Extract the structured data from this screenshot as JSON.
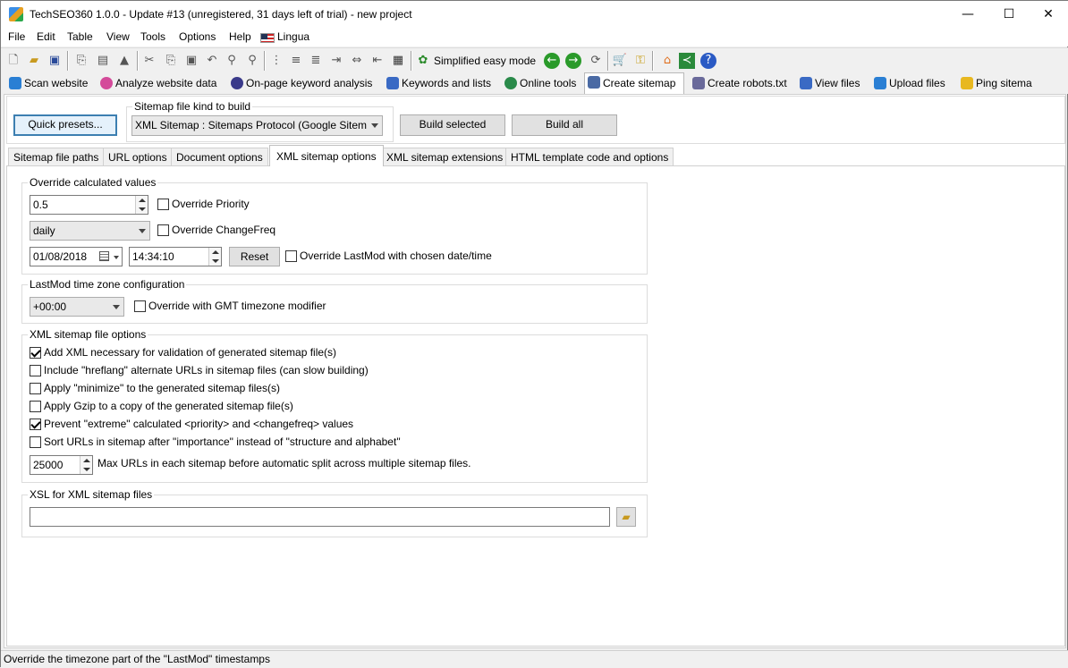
{
  "window": {
    "title": "TechSEO360 1.0.0 - Update #13 (unregistered, 31 days left of trial) - new project",
    "minimize": "—",
    "maximize": "☐",
    "close": "✕"
  },
  "menu": [
    "File",
    "Edit",
    "Table",
    "View",
    "Tools",
    "Options",
    "Help",
    "Lingua"
  ],
  "toolbar": {
    "simplified_mode": "Simplified easy mode"
  },
  "main_tabs": [
    {
      "label": "Scan website",
      "color": "#2a7fd4"
    },
    {
      "label": "Analyze website data",
      "color": "#d44a9a"
    },
    {
      "label": "On-page keyword analysis",
      "color": "#3a3a8a"
    },
    {
      "label": "Keywords and lists",
      "color": "#3a6ac4"
    },
    {
      "label": "Online tools",
      "color": "#2a8a4a"
    },
    {
      "label": "Create sitemap",
      "color": "#4a6aa4"
    },
    {
      "label": "Create robots.txt",
      "color": "#6a6a9a"
    },
    {
      "label": "View files",
      "color": "#3a6ac4"
    },
    {
      "label": "Upload files",
      "color": "#2a7fd4"
    },
    {
      "label": "Ping sitema",
      "color": "#e8b820"
    }
  ],
  "tab_scroll": {
    "left": "◂",
    "right": "▸"
  },
  "sitemap": {
    "quick_presets": "Quick presets...",
    "kind_label": "Sitemap file kind to build",
    "kind_value": "XML Sitemap : Sitemaps Protocol (Google Sitem",
    "build_selected": "Build selected",
    "build_all": "Build all"
  },
  "sub_tabs": [
    "Sitemap file paths",
    "URL options",
    "Document options",
    "XML sitemap options",
    "XML sitemap extensions",
    "HTML template code and options"
  ],
  "override": {
    "title": "Override calculated values",
    "priority_value": "0.5",
    "priority_label": "Override Priority",
    "changefreq_value": "daily",
    "changefreq_label": "Override ChangeFreq",
    "date_value": "01/08/2018",
    "time_value": "14:34:10",
    "reset": "Reset",
    "lastmod_label": "Override LastMod with chosen date/time"
  },
  "timezone": {
    "title": "LastMod time zone configuration",
    "value": "+00:00",
    "label": "Override with GMT timezone modifier"
  },
  "xml_options": {
    "title": "XML sitemap file options",
    "items": [
      {
        "label": "Add XML necessary for validation of generated sitemap file(s)",
        "checked": true
      },
      {
        "label": "Include \"hreflang\" alternate URLs in sitemap files (can slow building)",
        "checked": false
      },
      {
        "label": "Apply \"minimize\" to the generated sitemap files(s)",
        "checked": false
      },
      {
        "label": "Apply Gzip to a copy of the generated sitemap file(s)",
        "checked": false
      },
      {
        "label": "Prevent \"extreme\" calculated <priority> and <changefreq> values",
        "checked": true
      },
      {
        "label": "Sort URLs in sitemap after \"importance\" instead of \"structure and alphabet\"",
        "checked": false
      }
    ],
    "max_urls_value": "25000",
    "max_urls_label": "Max URLs in each sitemap before automatic split across multiple sitemap files."
  },
  "xsl": {
    "title": "XSL for XML sitemap files",
    "value": ""
  },
  "status_text": "Override the timezone part of the \"LastMod\" timestamps"
}
